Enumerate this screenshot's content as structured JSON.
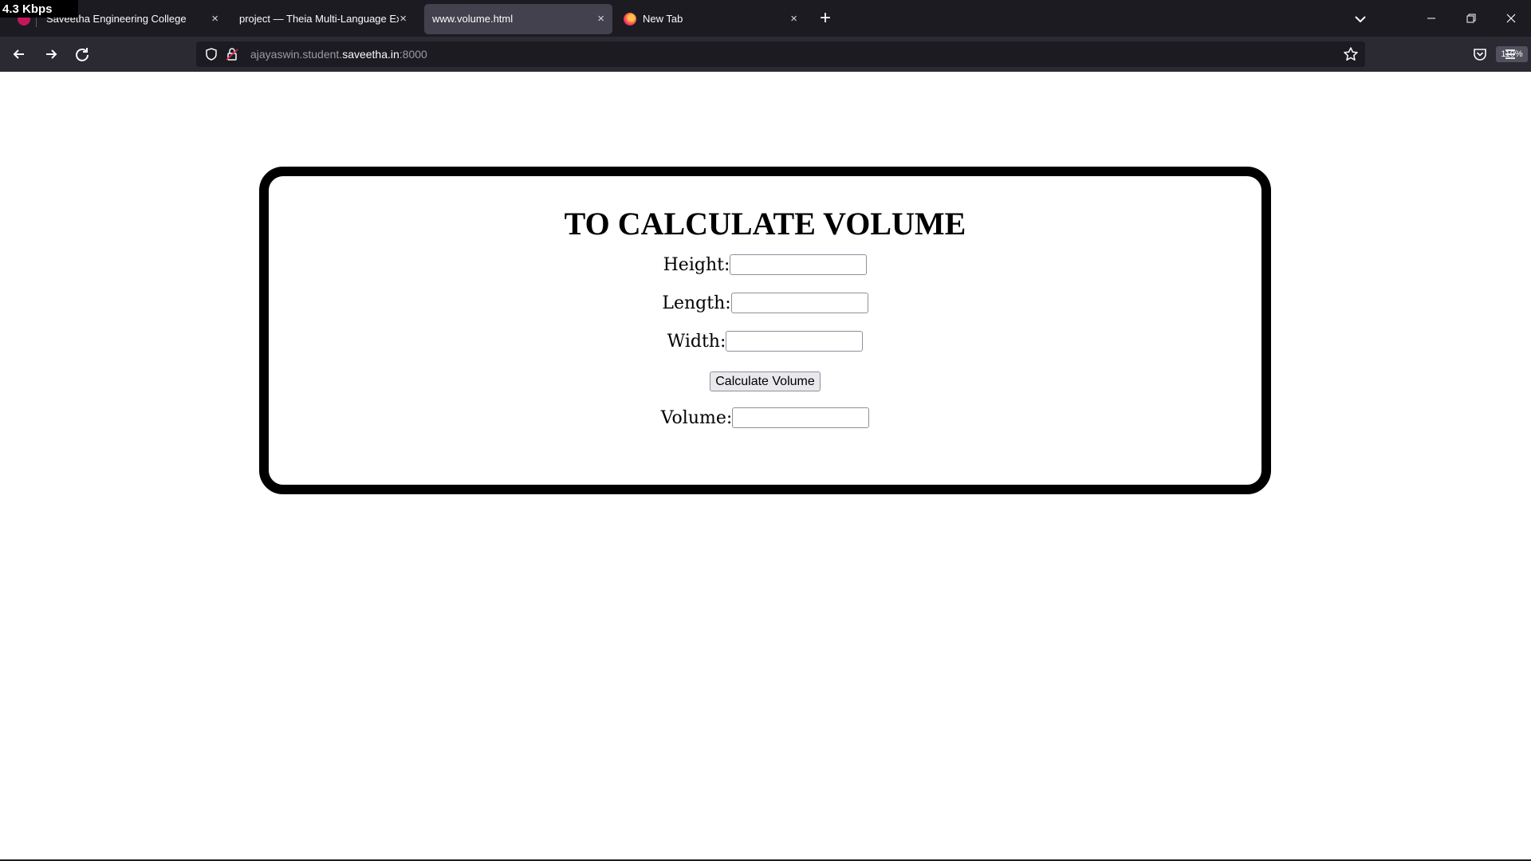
{
  "overlay": {
    "speed": "4.3 Kbps"
  },
  "tabs": [
    {
      "title": "Saveetha Engineering College",
      "close": "×"
    },
    {
      "title": "project — Theia Multi-Language Exam",
      "close": "×"
    },
    {
      "title": "www.volume.html",
      "close": "×",
      "active": true
    },
    {
      "title": "New Tab",
      "close": "×"
    }
  ],
  "toolbar": {
    "new_tab": "+",
    "url_prefix": "ajayaswin.student.",
    "url_host": "saveetha.in",
    "url_port": ":8000",
    "zoom": "110%"
  },
  "page": {
    "heading": "TO CALCULATE VOLUME",
    "height_label": "Height:",
    "height_value": "",
    "length_label": "Length:",
    "length_value": "",
    "width_label": "Width:",
    "width_value": "",
    "button_label": "Calculate Volume",
    "volume_label": "Volume:",
    "volume_value": ""
  },
  "colors": {
    "toolbar_bg": "#2b2a33",
    "tabstrip_bg": "#1c1b22",
    "active_tab": "#42414d",
    "card_border": "#000000"
  }
}
